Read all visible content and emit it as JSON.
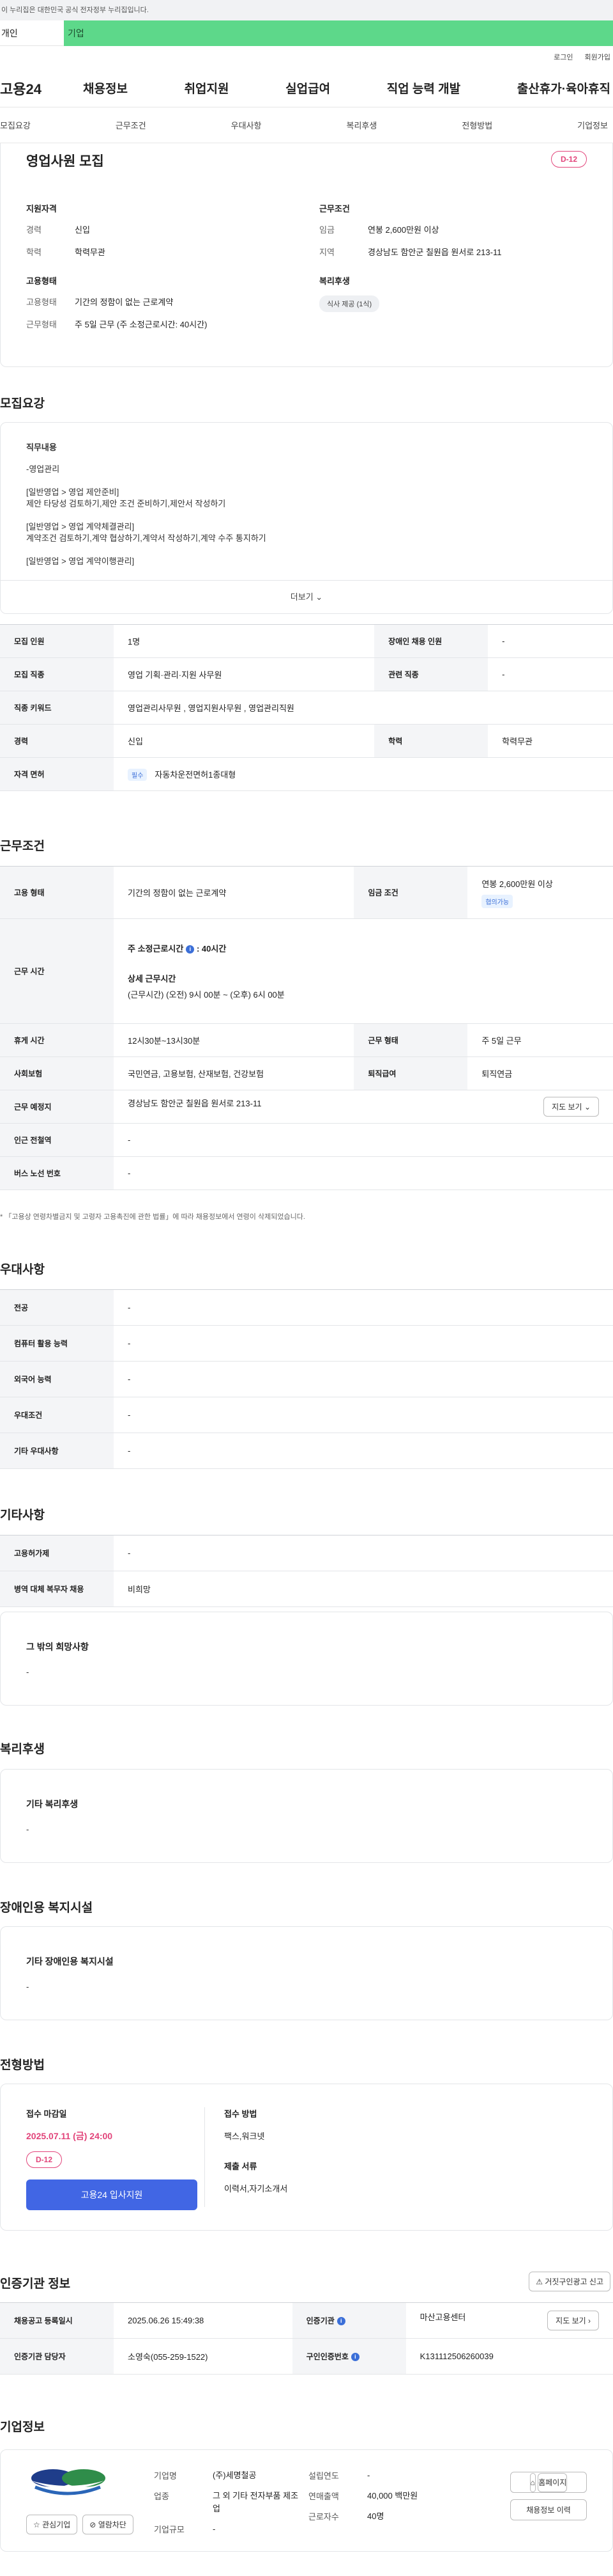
{
  "notice": {
    "text": "이 누리집은 대한민국 공식 전자정부 누리집입니다."
  },
  "usertabs": {
    "person": "개인",
    "company": "기업"
  },
  "utility": {
    "login": "로그인",
    "join": "회원가입"
  },
  "gnb": {
    "logo": "고용24",
    "menu": [
      "채용정보",
      "취업지원",
      "실업급여",
      "직업 능력 개발",
      "출산휴가·육아휴직"
    ]
  },
  "subtabs": [
    "모집요강",
    "근무조건",
    "우대사항",
    "복리후생",
    "전형방법",
    "기업정보"
  ],
  "summary": {
    "title": "영업사원 모집",
    "dday": "D-12",
    "qual_title": "지원자격",
    "qual": [
      {
        "k": "경력",
        "v": "신입"
      },
      {
        "k": "학력",
        "v": "학력무관"
      }
    ],
    "emp_title": "고용형태",
    "emp": [
      {
        "k": "고용형태",
        "v": "기간의 정함이 없는 근로계약"
      },
      {
        "k": "근무형태",
        "v": "주 5일 근무 (주 소정근로시간: 40시간)"
      }
    ],
    "cond_title": "근무조건",
    "cond": [
      {
        "k": "임금",
        "v": "연봉 2,600만원 이상"
      },
      {
        "k": "지역",
        "v": "경상남도 함안군 칠원읍 원서로 213-11"
      }
    ],
    "benefit_title": "복리후생",
    "benefit_tag": "식사 제공 (1식)"
  },
  "recruit": {
    "section": "모집요강",
    "duty_title": "직무내용",
    "duty_text": "-영업관리\n\n[일반영업 > 영업 제안준비]\n제안 타당성 검토하기,제안 조건 준비하기,제안서 작성하기\n\n[일반영업 > 영업 계약체결관리]\n계약조건 검토하기,계약 협상하기,계약서 작성하기,계약 수주 통지하기\n\n[일반영업 > 영업 계약이행관리]",
    "more": "더보기",
    "rows": [
      {
        "k1": "모집 인원",
        "v1": "1명",
        "k2": "장애인 채용 인원",
        "v2": "-"
      },
      {
        "k1": "모집 직종",
        "v1": "영업 기획·관리·지원 사무원",
        "k2": "관련 직종",
        "v2": "-"
      },
      {
        "k1": "직종 키워드",
        "v1": "영업관리사무원 , 영업지원사무원 , 영업관리직원",
        "k2": "",
        "v2": ""
      },
      {
        "k1": "경력",
        "v1": "신입",
        "k2": "학력",
        "v2": "학력무관"
      }
    ],
    "license_key": "자격 면허",
    "license_tag": "필수",
    "license_val": "자동차운전면허1종대형"
  },
  "work": {
    "section": "근무조건",
    "emp_k": "고용 형태",
    "emp_v": "기간의 정함이 없는 근로계약",
    "wage_k": "임금 조건",
    "wage_v": "연봉 2,600만원 이상",
    "wage_tag": "협의가능",
    "hours_k": "근무 시간",
    "hours_h1": "주 소정근로시간",
    "hours_v1": ": 40시간",
    "hours_h2": "상세 근무시간",
    "hours_v2": "(근무시간) (오전) 9시 00분 ~ (오후) 6시 00분",
    "rest_k": "휴게 시간",
    "rest_v": "12시30분~13시30분",
    "type_k": "근무 형태",
    "type_v": "주 5일 근무",
    "ins_k": "사회보험",
    "ins_v": "국민연금, 고용보험, 산재보험, 건강보험",
    "sev_k": "퇴직급여",
    "sev_v": "퇴직연금",
    "addr_k": "근무 예정지",
    "addr_v": "경상남도 함안군 칠원읍 원서로 213-11",
    "map": "지도 보기",
    "sub_k": "인근 전철역",
    "sub_v": "-",
    "bus_k": "버스 노선 번호",
    "bus_v": "-",
    "note": "* 「고용상 연령차별금지 및 고령자 고용촉진에 관한 법률」에 따라 채용정보에서 연령이 삭제되었습니다."
  },
  "pref": {
    "section": "우대사항",
    "rows": [
      {
        "k": "전공",
        "v": "-"
      },
      {
        "k": "컴퓨터 활용 능력",
        "v": "-"
      },
      {
        "k": "외국어 능력",
        "v": "-"
      },
      {
        "k": "우대조건",
        "v": "-"
      },
      {
        "k": "기타 우대사항",
        "v": "-"
      }
    ]
  },
  "etc": {
    "section": "기타사항",
    "rows": [
      {
        "k": "고용허가제",
        "v": "-"
      },
      {
        "k": "병역 대체 복무자 채용",
        "v": "비희망"
      }
    ],
    "box_h": "그 밖의 희망사항",
    "box_v": "-"
  },
  "welfare": {
    "section": "복리후생",
    "h": "기타 복리후생",
    "v": "-"
  },
  "disabled": {
    "section": "장애인용 복지시설",
    "h": "기타 장애인용 복지시설",
    "v": "-"
  },
  "process": {
    "section": "전형방법",
    "deadline_h": "접수 마감일",
    "deadline": "2025.07.11 (금) 24:00",
    "dday": "D-12",
    "apply_btn": "고용24 입사지원",
    "method_h": "접수 방법",
    "method_v": "팩스,워크넷",
    "docs_h": "제출 서류",
    "docs_v": "이력서,자기소개서"
  },
  "cert": {
    "section": "인증기관 정보",
    "report_btn": "거짓구인광고 신고",
    "rows": [
      {
        "k1": "채용공고 등록일시",
        "v1": "2025.06.26 15:49:38",
        "k2": "인증기관",
        "v2": "마산고용센터",
        "btn": "지도 보기"
      },
      {
        "k1": "인증기관 담당자",
        "v1": "소영숙(055-259-1522)",
        "k2": "구인인증번호",
        "v2": "K131112506260039",
        "btn": ""
      }
    ]
  },
  "corp": {
    "section": "기업정보",
    "interest": "관심기업",
    "block": "열람차단",
    "rows1": [
      {
        "k": "기업명",
        "v": "(주)세명철공"
      },
      {
        "k": "업종",
        "v": "그 외 기타 전자부품 제조업"
      },
      {
        "k": "기업규모",
        "v": "-"
      }
    ],
    "rows2": [
      {
        "k": "설립연도",
        "v": "-"
      },
      {
        "k": "연매출액",
        "v": "40,000 백만원"
      },
      {
        "k": "근로자수",
        "v": "40명"
      }
    ],
    "homepage": "홈페이지",
    "history": "채용정보 이력"
  }
}
